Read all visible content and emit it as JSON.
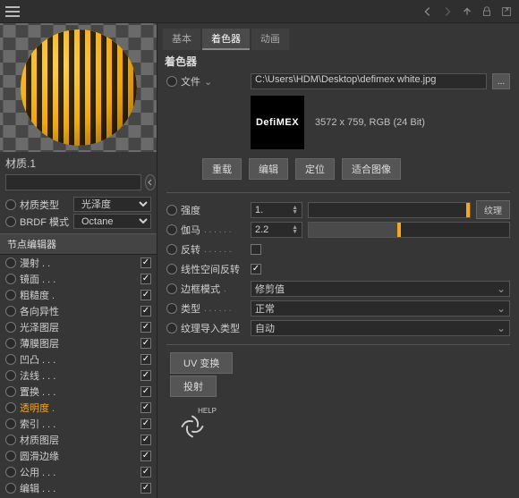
{
  "sidebar": {
    "material_name": "材质.1",
    "search": "",
    "prop_material_type": {
      "label": "材质类型",
      "value": "光泽度"
    },
    "prop_brdf_mode": {
      "label": "BRDF 模式",
      "value": "Octane"
    },
    "section_editor": "节点编辑器",
    "channels": [
      {
        "label": "漫射 . .",
        "checked": true
      },
      {
        "label": "镜面 . . .",
        "checked": true
      },
      {
        "label": "粗糙度 .",
        "checked": true
      },
      {
        "label": "各向异性",
        "checked": true
      },
      {
        "label": "光泽图层",
        "checked": true
      },
      {
        "label": "薄膜图层",
        "checked": true
      },
      {
        "label": "凹凸 . . .",
        "checked": true
      },
      {
        "label": "法线 . . .",
        "checked": true
      },
      {
        "label": "置换 . . .",
        "checked": true
      },
      {
        "label": "透明度 .",
        "checked": true,
        "active": true
      },
      {
        "label": "索引 . . .",
        "checked": true
      },
      {
        "label": "材质图层",
        "checked": true
      },
      {
        "label": "圆滑边缘",
        "checked": true
      },
      {
        "label": "公用 . . .",
        "checked": true
      },
      {
        "label": "编辑 . . .",
        "checked": true
      }
    ]
  },
  "panel": {
    "tabs": [
      {
        "label": "基本",
        "active": false
      },
      {
        "label": "着色器",
        "active": true
      },
      {
        "label": "动画",
        "active": false
      }
    ],
    "group_title": "着色器",
    "file_label": "文件",
    "file_path": "C:\\Users\\HDM\\Desktop\\defimex white.jpg",
    "thumb_text": "DefiMEX",
    "image_info": "3572 x 759, RGB (24 Bit)",
    "btns": {
      "reload": "重载",
      "edit": "编辑",
      "locate": "定位",
      "fit": "适合图像"
    },
    "strength": {
      "label": "强度",
      "value": "1."
    },
    "gamma": {
      "label": "伽马",
      "dots": ". . . . . .",
      "value": "2.2"
    },
    "invert": {
      "label": "反转",
      "dots": ". . . . . .",
      "checked": false
    },
    "linear": {
      "label": "线性空间反转",
      "checked": true
    },
    "border_mode": {
      "label": "边框模式",
      "dots": ".",
      "value": "修剪值"
    },
    "type_row": {
      "label": "类型",
      "dots": ". . . . . .",
      "value": "正常"
    },
    "import_type": {
      "label": "纹理导入类型",
      "value": "自动"
    },
    "uv_btn": "UV 变换",
    "project_btn": "投射",
    "tex_btn": "纹理",
    "help": "HELP"
  }
}
